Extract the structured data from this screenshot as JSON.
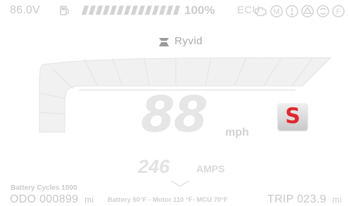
{
  "status": {
    "voltage": "86.0V",
    "battery_percent": "100%",
    "battery_level": 1.0,
    "ecu_label": "ECU",
    "icons": [
      "fuel-icon",
      "battery-bar",
      "engine-warning-icon",
      "motor-warning-icon",
      "general-warning-icon",
      "brake-warning-icon",
      "tire-warning-icon",
      "f-warning-icon"
    ]
  },
  "brand": {
    "name": "Ryvid"
  },
  "speed": {
    "value": "88",
    "unit": "mph"
  },
  "mode": {
    "letter": "S",
    "color": "#e1262f"
  },
  "current": {
    "value": "246",
    "unit": "AMPS"
  },
  "info": {
    "battery_cycles_label": "Battery Cycles",
    "battery_cycles_value": "1000",
    "odo_label": "ODO",
    "odo_value": "000899",
    "odo_unit": "mi",
    "temps": "Battery 50°F - Motor 110 °F- MCU 70°F",
    "trip_label": "TRIP",
    "trip_value": "023.9",
    "trip_unit": "mi"
  }
}
